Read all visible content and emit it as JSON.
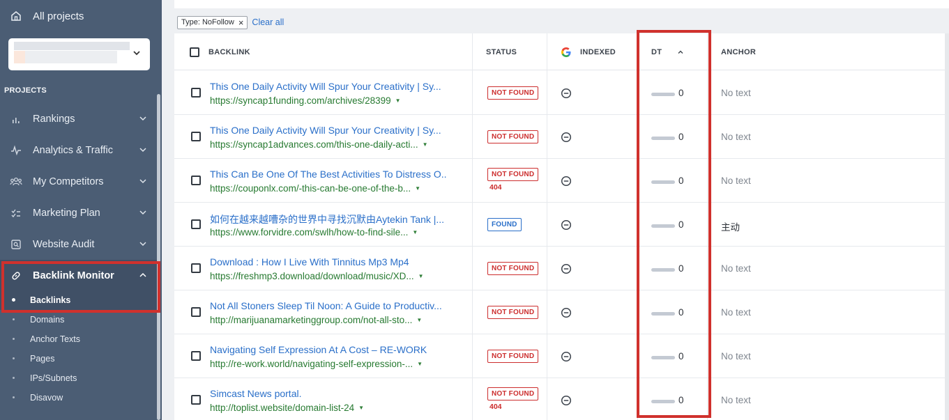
{
  "sidebar": {
    "all_projects": "All projects",
    "section_label": "PROJECTS",
    "items": [
      {
        "label": "Rankings"
      },
      {
        "label": "Analytics & Traffic"
      },
      {
        "label": "My Competitors"
      },
      {
        "label": "Marketing Plan"
      },
      {
        "label": "Website Audit"
      },
      {
        "label": "Backlink Monitor"
      }
    ],
    "sub_items": [
      {
        "label": "Backlinks"
      },
      {
        "label": "Domains"
      },
      {
        "label": "Anchor Texts"
      },
      {
        "label": "Pages"
      },
      {
        "label": "IPs/Subnets"
      },
      {
        "label": "Disavow"
      }
    ]
  },
  "filters": {
    "chip_key": "Type:",
    "chip_value": "NoFollow",
    "clear_all": "Clear all"
  },
  "table": {
    "headers": {
      "backlink": "BACKLINK",
      "status": "STATUS",
      "indexed": "INDEXED",
      "dt": "DT",
      "anchor": "ANCHOR"
    },
    "rows": [
      {
        "title": "This One Daily Activity Will Spur Your Creativity | Sy...",
        "url": "https://syncap1funding.com/archives/28399",
        "status": "NOT FOUND",
        "code": "",
        "dt": "0",
        "anchor": "No text"
      },
      {
        "title": "This One Daily Activity Will Spur Your Creativity | Sy...",
        "url": "https://syncap1advances.com/this-one-daily-acti...",
        "status": "NOT FOUND",
        "code": "",
        "dt": "0",
        "anchor": "No text"
      },
      {
        "title": "This Can Be One Of The Best Activities To Distress O...",
        "url": "https://couponlx.com/-this-can-be-one-of-the-b...",
        "status": "NOT FOUND",
        "code": "404",
        "dt": "0",
        "anchor": "No text"
      },
      {
        "title": "如何在越来越嘈杂的世界中寻找沉默由Aytekin Tank |...",
        "url": "https://www.forvidre.com/swlh/how-to-find-sile...",
        "status": "FOUND",
        "code": "",
        "dt": "0",
        "anchor": "主动"
      },
      {
        "title": "Download : How I Live With Tinnitus Mp3 Mp4",
        "url": "https://freshmp3.download/download/music/XD...",
        "status": "NOT FOUND",
        "code": "",
        "dt": "0",
        "anchor": "No text"
      },
      {
        "title": "Not All Stoners Sleep Til Noon: A Guide to Productiv...",
        "url": "http://marijuanamarketinggroup.com/not-all-sto...",
        "status": "NOT FOUND",
        "code": "",
        "dt": "0",
        "anchor": "No text"
      },
      {
        "title": "Navigating Self Expression At A Cost – RE-WORK",
        "url": "http://re-work.world/navigating-self-expression-...",
        "status": "NOT FOUND",
        "code": "",
        "dt": "0",
        "anchor": "No text"
      },
      {
        "title": "Simcast News portal.",
        "url": "http://toplist.website/domain-list-24",
        "status": "NOT FOUND",
        "code": "404",
        "dt": "0",
        "anchor": "No text"
      }
    ]
  },
  "colors": {
    "sidebar_bg": "#4b5d74",
    "link_blue": "#2a6fc9",
    "url_green": "#277a31",
    "status_red": "#cc2d2d",
    "highlight_red": "#d0312d"
  }
}
